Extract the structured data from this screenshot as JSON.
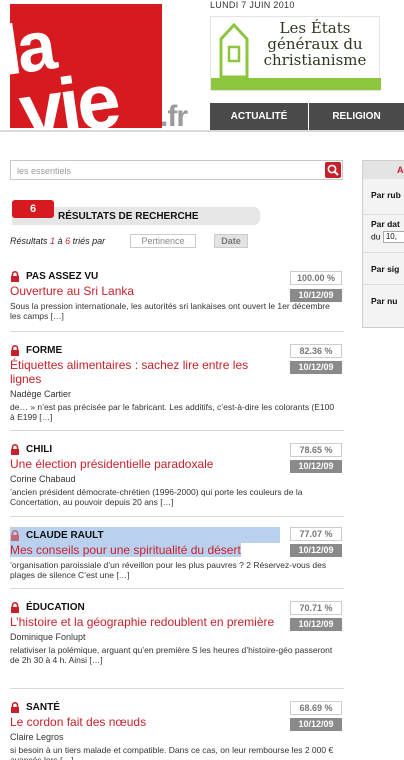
{
  "header": {
    "logo_text": "la vie",
    "logo_domain": ".fr",
    "date": "LUNDI 7 JUIN 2010",
    "banner_text": "Les États généraux du christianisme",
    "nav": [
      {
        "label": "ACTUALITÉ"
      },
      {
        "label": "RELIGION"
      }
    ]
  },
  "search": {
    "value": "les essentiels"
  },
  "results_header": {
    "count": "6",
    "title": "RÉSULTATS DE RECHERCHE",
    "range_prefix": "Résultats ",
    "range_from": "1",
    "range_sep": " à ",
    "range_to": "6",
    "range_suffix": " triés par",
    "sort_relevance": "Pertinence",
    "sort_date": "Date"
  },
  "results": [
    {
      "category": "PAS ASSEZ VU",
      "title": "Ouverture au Sri Lanka",
      "author": "",
      "snippet": "Sous la pression internationale, les autorités sri lankaises ont ouvert le 1er décembre les camps […]",
      "score": "100.00 %",
      "date": "10/12/09"
    },
    {
      "category": "FORME",
      "title": "Étiquettes alimentaires : sachez lire entre les lignes",
      "author": "Nadège Cartier",
      "snippet": "de… » n’est pas précisée par le fabricant. Les additifs, c’est-à-dire les colorants (E100 à E199 […]",
      "score": "82.36 %",
      "date": "10/12/09"
    },
    {
      "category": "CHILI",
      "title": "Une élection présidentielle paradoxale",
      "author": "Corine Chabaud",
      "snippet": "’ancien président démocrate-chrétien (1996-2000) qui porte les couleurs de la Concertation, au pouvoir depuis 20 ans […]",
      "score": "78.65 %",
      "date": "10/12/09"
    },
    {
      "category": "CLAUDE RAULT",
      "title": "Mes conseils pour une spiritualité du désert",
      "author": "",
      "snippet": "’organisation paroissiale d’un réveillon pour les plus pauvres ? 2 Réservez-vous des plages de silence C’est une […]",
      "score": "77.07 %",
      "date": "10/12/09",
      "selected": true
    },
    {
      "category": "ÉDUCATION",
      "title": "L’histoire et la géographie redoublent en première",
      "author": "Dominique Fonlupt",
      "snippet": "relativiser la polémique, arguant qu’en première S les heures d’histoire-géo passeront de 2h 30 à 4 h. Ainsi […]",
      "score": "70.71 %",
      "date": "10/12/09"
    },
    {
      "category": "SANTÉ",
      "title": "Le cordon fait des nœuds",
      "author": "Claire Legros",
      "snippet": "si besoin à un tiers malade et compatible. Dans ce cas, on leur rembourse les 2 000 € avancés lors […]",
      "score": "68.69 %",
      "date": "10/12/09"
    }
  ],
  "side_panel": {
    "head": "A",
    "rows": [
      "Par rub",
      "Par dat",
      "Par sig",
      "Par nu"
    ],
    "du_label": "du",
    "du_value": "10,"
  },
  "colors": {
    "brand_red": "#d71920",
    "link_red": "#c8202a",
    "nav_bg": "#4a4a4a",
    "selection": "#b9d1ef",
    "banner_green": "#8cc63f"
  }
}
